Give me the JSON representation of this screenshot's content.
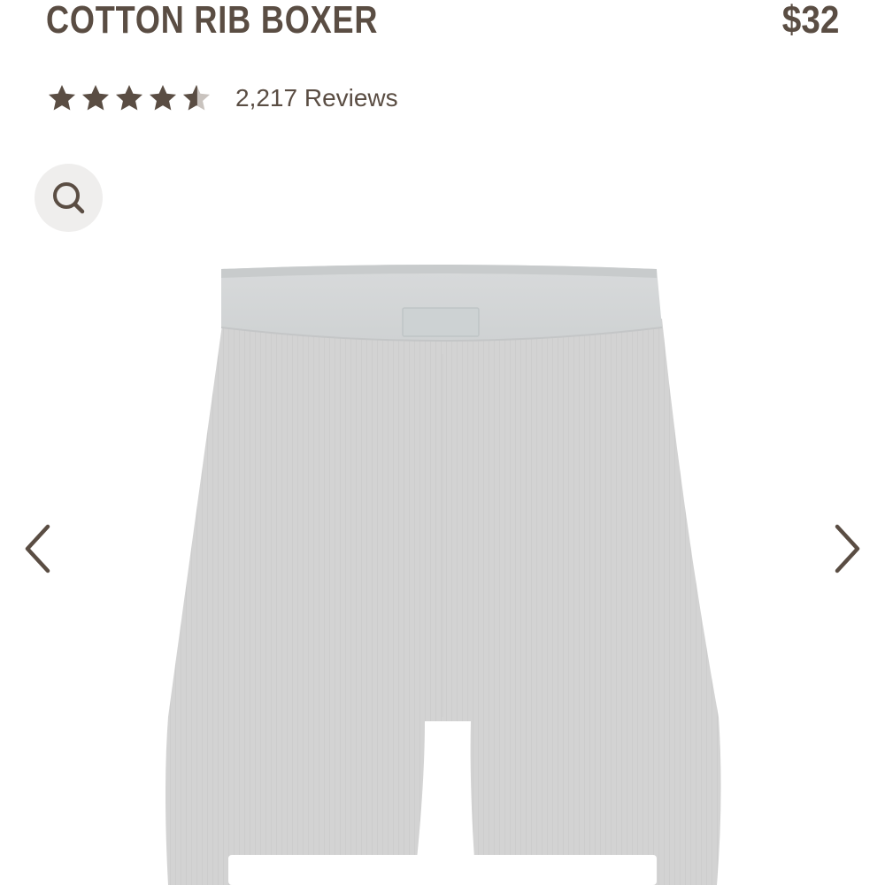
{
  "product": {
    "title": "COTTON RIB BOXER",
    "price": "$32"
  },
  "rating": {
    "stars": 4.5,
    "max_stars": 5,
    "reviews_label": "2,217 Reviews"
  },
  "gallery": {
    "search_icon": "search-icon",
    "prev_icon": "chevron-left-icon",
    "next_icon": "chevron-right-icon",
    "product_color": "#d3d3d3"
  },
  "colors": {
    "brand_text": "#5a4d43",
    "search_bg": "#efeeed"
  }
}
